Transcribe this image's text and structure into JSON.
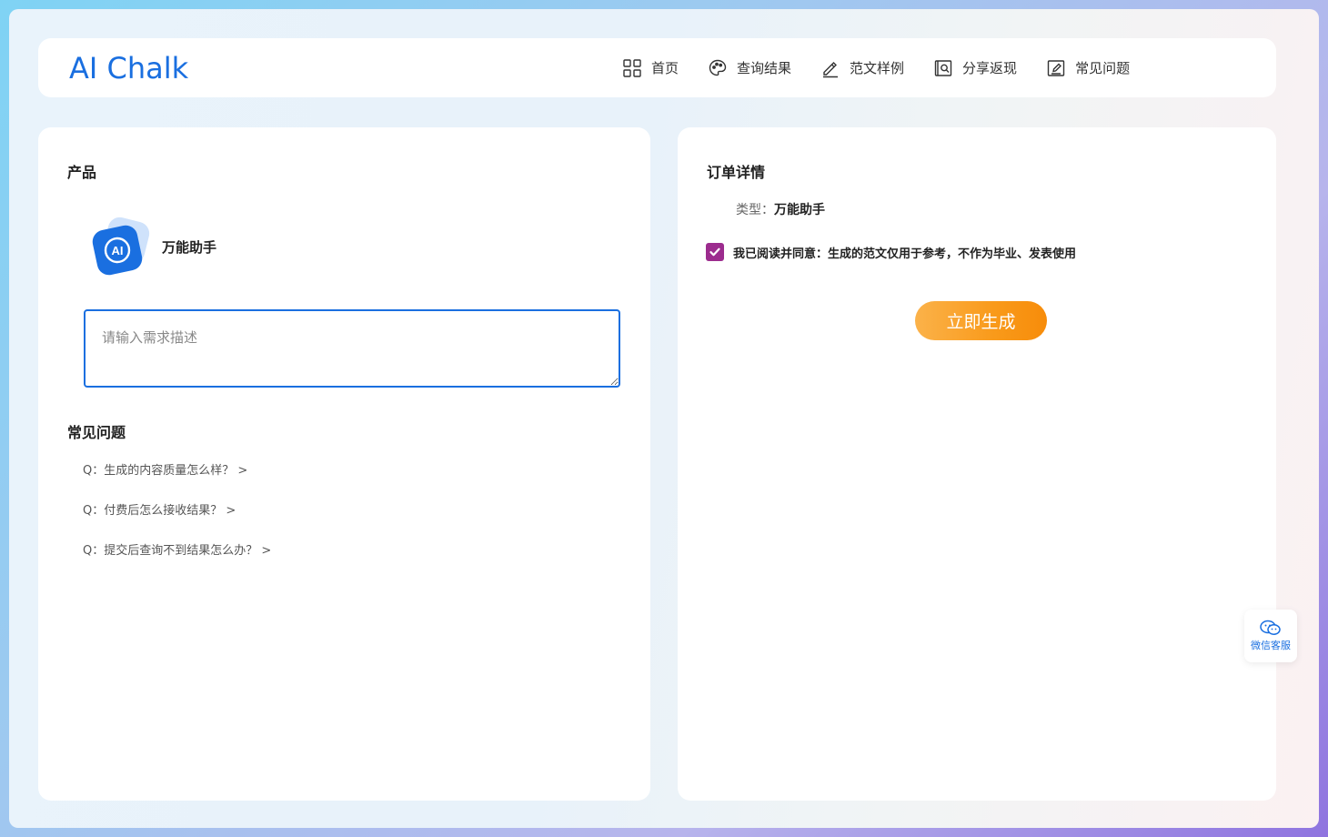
{
  "header": {
    "logo": "AI Chalk",
    "nav": [
      {
        "label": "首页",
        "icon": "grid-icon"
      },
      {
        "label": "查询结果",
        "icon": "palette-icon"
      },
      {
        "label": "范文样例",
        "icon": "pencil-icon"
      },
      {
        "label": "分享返现",
        "icon": "search-doc-icon"
      },
      {
        "label": "常见问题",
        "icon": "edit-doc-icon"
      }
    ]
  },
  "left": {
    "product_title": "产品",
    "product_name": "万能助手",
    "product_icon_text": "AI",
    "textarea_placeholder": "请输入需求描述",
    "faq_title": "常见问题",
    "faq": [
      "Q：生成的内容质量怎么样？ >",
      "Q：付费后怎么接收结果？ >",
      "Q：提交后查询不到结果怎么办？ >"
    ]
  },
  "right": {
    "title": "订单详情",
    "type_label": "类型：",
    "type_value": "万能助手",
    "agree_checked": true,
    "agree_text": "我已阅读并同意：生成的范文仅用于参考，不作为毕业、发表使用",
    "generate_label": "立即生成"
  },
  "float": {
    "wechat_label": "微信客服"
  },
  "colors": {
    "accent": "#1a6fe0",
    "button_orange": "#f99a1a",
    "checkbox": "#9c2c8e"
  }
}
